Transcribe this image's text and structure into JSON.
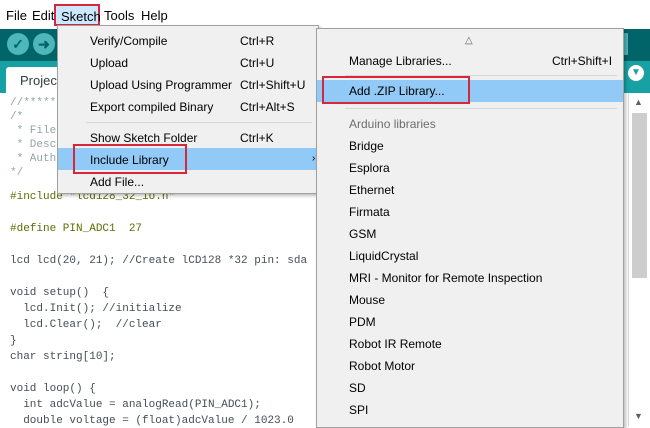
{
  "menubar": {
    "items": [
      "File",
      "Edit",
      "Sketch",
      "Tools",
      "Help"
    ]
  },
  "tab": {
    "label": "Project"
  },
  "colors": {
    "toolbar": "#006468",
    "tabstrip": "#17a1a5",
    "highlight": "#91c9f7",
    "annotation_box": "#d6283a"
  },
  "code_lines": [
    "//*****",
    "/*",
    " * File",
    " * Desc",
    " * Auth",
    "*/",
    "#include \"lcd128_32_io.h\"",
    "",
    "#define PIN_ADC1  27",
    "",
    "lcd lcd(20, 21); //Create lCD128 *32 pin: sda",
    "",
    "void setup()  {",
    "  lcd.Init(); //initialize",
    "  lcd.Clear();  //clear",
    "}",
    "char string[10];",
    "",
    "void loop() {",
    "  int adcValue = analogRead(PIN_ADC1);",
    "  double voltage = (float)adcValue / 1023.0"
  ],
  "sketch_menu": {
    "items": [
      {
        "label": "Verify/Compile",
        "shortcut": "Ctrl+R"
      },
      {
        "label": "Upload",
        "shortcut": "Ctrl+U"
      },
      {
        "label": "Upload Using Programmer",
        "shortcut": "Ctrl+Shift+U"
      },
      {
        "label": "Export compiled Binary",
        "shortcut": "Ctrl+Alt+S"
      },
      {
        "label": "Show Sketch Folder",
        "shortcut": "Ctrl+K"
      },
      {
        "label": "Include Library",
        "shortcut": ""
      },
      {
        "label": "Add File...",
        "shortcut": ""
      }
    ],
    "submenu_indicator": "›"
  },
  "library_menu": {
    "scroll_up_indicator": "△",
    "manage": {
      "label": "Manage Libraries...",
      "shortcut": "Ctrl+Shift+I"
    },
    "add_zip": {
      "label": "Add .ZIP Library..."
    },
    "section_header": "Arduino libraries",
    "libraries": [
      "Bridge",
      "Esplora",
      "Ethernet",
      "Firmata",
      "GSM",
      "LiquidCrystal",
      "MRI - Monitor for Remote Inspection",
      "Mouse",
      "PDM",
      "Robot IR Remote",
      "Robot Motor",
      "SD",
      "SPI"
    ]
  }
}
